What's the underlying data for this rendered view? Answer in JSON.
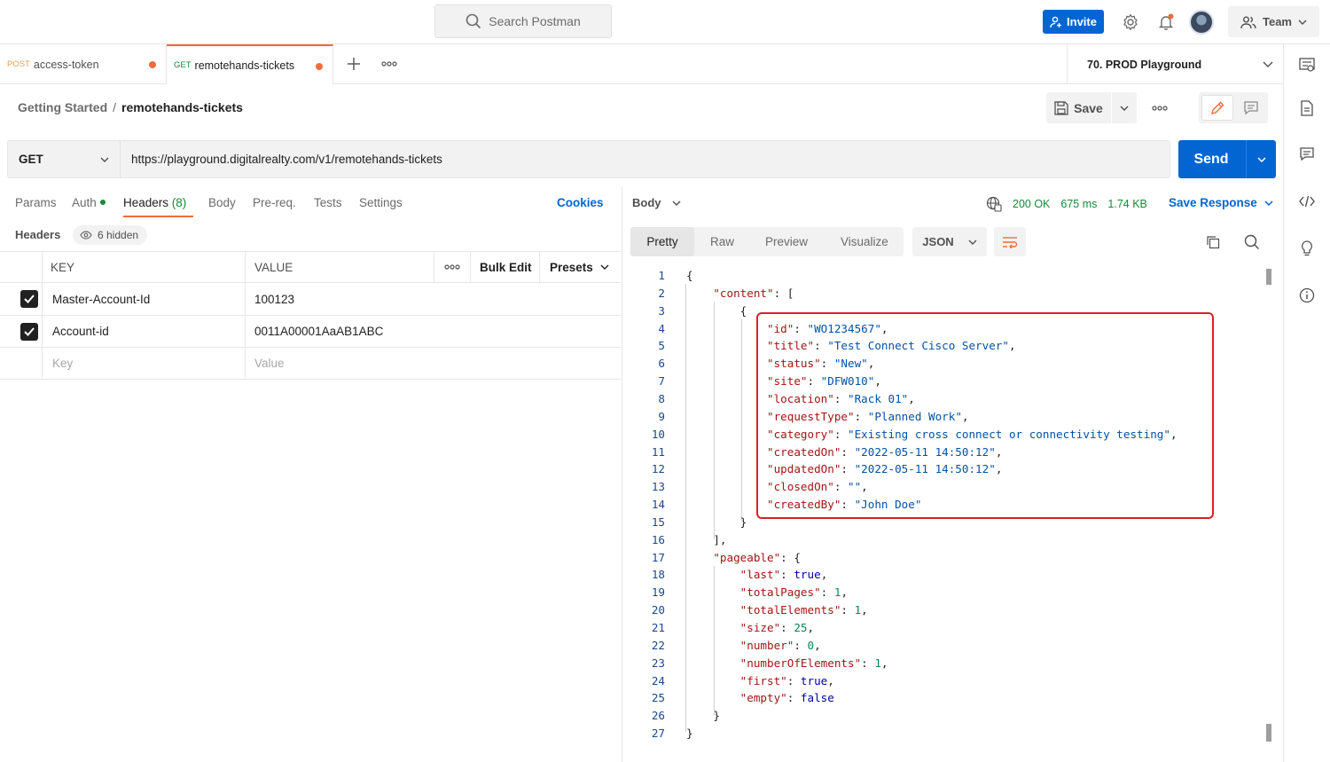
{
  "search": {
    "label": "Search Postman"
  },
  "topbar": {
    "invite_label": "Invite",
    "team_label": "Team"
  },
  "tabs": [
    {
      "method": "POST",
      "name": "access-token"
    },
    {
      "method": "GET",
      "name": "remotehands-tickets"
    }
  ],
  "environment": {
    "selected": "70. PROD Playground"
  },
  "breadcrumb": {
    "parent": "Getting Started",
    "separator": "/",
    "current": "remotehands-tickets"
  },
  "toolbar": {
    "save_label": "Save"
  },
  "request": {
    "method": "GET",
    "url": "https://playground.digitalrealty.com/v1/remotehands-tickets",
    "send_label": "Send"
  },
  "request_tabs": {
    "params": "Params",
    "auth": "Auth",
    "headers": "Headers",
    "headers_count": "(8)",
    "body": "Body",
    "prereq": "Pre-req.",
    "tests": "Tests",
    "settings": "Settings",
    "cookies": "Cookies"
  },
  "headers_section": {
    "title": "Headers",
    "hidden": "6 hidden"
  },
  "headers_table": {
    "col_key": "KEY",
    "col_value": "VALUE",
    "bulk_edit": "Bulk Edit",
    "presets": "Presets",
    "rows": [
      {
        "checked": true,
        "key": "Master-Account-Id",
        "value": "100123"
      },
      {
        "checked": true,
        "key": "Account-id",
        "value": "0011A00001AaAB1ABC"
      }
    ],
    "key_placeholder": "Key",
    "value_placeholder": "Value"
  },
  "response": {
    "body_label": "Body",
    "status": "200 OK",
    "time": "675 ms",
    "size": "1.74 KB",
    "save_response": "Save Response",
    "views": [
      "Pretty",
      "Raw",
      "Preview",
      "Visualize"
    ],
    "format": "JSON"
  },
  "code_lines": [
    "1",
    "2",
    "3",
    "4",
    "5",
    "6",
    "7",
    "8",
    "9",
    "10",
    "11",
    "12",
    "13",
    "14",
    "15",
    "16",
    "17",
    "18",
    "19",
    "20",
    "21",
    "22",
    "23",
    "24",
    "25",
    "26",
    "27"
  ],
  "json": {
    "content_key": "\"content\"",
    "fields": [
      {
        "key": "\"id\"",
        "value": "\"WO1234567\"",
        "tail": ","
      },
      {
        "key": "\"title\"",
        "value": "\"Test Connect Cisco Server\"",
        "tail": ","
      },
      {
        "key": "\"status\"",
        "value": "\"New\"",
        "tail": ","
      },
      {
        "key": "\"site\"",
        "value": "\"DFW010\"",
        "tail": ","
      },
      {
        "key": "\"location\"",
        "value": "\"Rack 01\"",
        "tail": ","
      },
      {
        "key": "\"requestType\"",
        "value": "\"Planned Work\"",
        "tail": ","
      },
      {
        "key": "\"category\"",
        "value": "\"Existing cross connect or connectivity testing\"",
        "tail": ","
      },
      {
        "key": "\"createdOn\"",
        "value": "\"2022-05-11 14:50:12\"",
        "tail": ","
      },
      {
        "key": "\"updatedOn\"",
        "value": "\"2022-05-11 14:50:12\"",
        "tail": ","
      },
      {
        "key": "\"closedOn\"",
        "value": "\"\"",
        "tail": ","
      },
      {
        "key": "\"createdBy\"",
        "value": "\"John Doe\"",
        "tail": ""
      }
    ],
    "pageable_key": "\"pageable\"",
    "pageable": [
      {
        "key": "\"last\"",
        "value": "true",
        "kind": "b",
        "tail": ","
      },
      {
        "key": "\"totalPages\"",
        "value": "1",
        "kind": "n",
        "tail": ","
      },
      {
        "key": "\"totalElements\"",
        "value": "1",
        "kind": "n",
        "tail": ","
      },
      {
        "key": "\"size\"",
        "value": "25",
        "kind": "n",
        "tail": ","
      },
      {
        "key": "\"number\"",
        "value": "0",
        "kind": "n",
        "tail": ","
      },
      {
        "key": "\"numberOfElements\"",
        "value": "1",
        "kind": "n",
        "tail": ","
      },
      {
        "key": "\"first\"",
        "value": "true",
        "kind": "b",
        "tail": ","
      },
      {
        "key": "\"empty\"",
        "value": "false",
        "kind": "b",
        "tail": ""
      }
    ]
  },
  "colors": {
    "accent": "#f26b3a",
    "primary": "#0265d2",
    "status_ok": "#168a35",
    "highlight_box": "#e11d26"
  },
  "icons": [
    "search-icon",
    "add-user-icon",
    "settings-gear-icon",
    "bell-icon",
    "team-icon",
    "chevron-down-icon",
    "plus-icon",
    "more-icon",
    "environment-icon",
    "save-icon",
    "pencil-icon",
    "comment-icon",
    "document-icon",
    "code-icon",
    "lightbulb-icon",
    "info-icon",
    "eye-icon",
    "check-icon",
    "globe-icon",
    "wrap-icon",
    "copy-icon"
  ]
}
